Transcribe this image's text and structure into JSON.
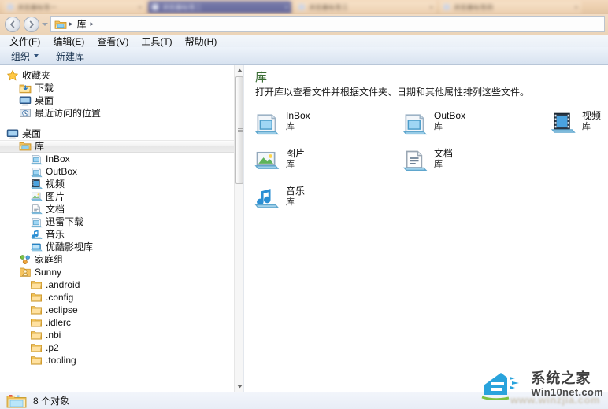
{
  "browser_tabs": {
    "tabs": [
      {
        "title": "浏览器标签一",
        "active": false,
        "icon": "page-icon",
        "close": "×"
      },
      {
        "title": "浏览器标签二",
        "active": true,
        "icon": "page-icon",
        "close": "×"
      },
      {
        "title": "浏览器标签三",
        "active": false,
        "icon": "page-icon",
        "close": "×"
      },
      {
        "title": "浏览器标签四",
        "active": false,
        "icon": "page-icon",
        "close": "×"
      }
    ]
  },
  "navbar": {
    "back_icon": "back-arrow-icon",
    "forward_icon": "forward-arrow-icon",
    "history_dropdown_icon": "chevron-down-icon",
    "address_icon": "library-icon",
    "breadcrumb": [
      "库"
    ],
    "separator": "▸"
  },
  "menubar": {
    "items": [
      {
        "label": "文件(F)",
        "accel": "F"
      },
      {
        "label": "编辑(E)",
        "accel": "E"
      },
      {
        "label": "查看(V)",
        "accel": "V"
      },
      {
        "label": "工具(T)",
        "accel": "T"
      },
      {
        "label": "帮助(H)",
        "accel": "H"
      }
    ]
  },
  "toolbar": {
    "organize_label": "组织",
    "new_library_label": "新建库"
  },
  "sidebar": {
    "groups": [
      {
        "header": {
          "label": "收藏夹",
          "icon": "star-icon",
          "indent": 0,
          "selected": false
        },
        "items": [
          {
            "label": "下载",
            "icon": "downloads-icon",
            "indent": 1,
            "selected": false
          },
          {
            "label": "桌面",
            "icon": "desktop-icon",
            "indent": 1,
            "selected": false
          },
          {
            "label": "最近访问的位置",
            "icon": "recent-places-icon",
            "indent": 1,
            "selected": false
          }
        ]
      },
      {
        "header": {
          "label": "桌面",
          "icon": "desktop-icon",
          "indent": 0,
          "selected": false
        },
        "items": [
          {
            "label": "库",
            "icon": "library-icon",
            "indent": 1,
            "selected": true
          },
          {
            "label": "InBox",
            "icon": "library-generic-icon",
            "indent": 2,
            "selected": false
          },
          {
            "label": "OutBox",
            "icon": "library-generic-icon",
            "indent": 2,
            "selected": false
          },
          {
            "label": "视频",
            "icon": "video-library-icon",
            "indent": 2,
            "selected": false
          },
          {
            "label": "图片",
            "icon": "pictures-library-icon",
            "indent": 2,
            "selected": false
          },
          {
            "label": "文档",
            "icon": "documents-library-icon",
            "indent": 2,
            "selected": false
          },
          {
            "label": "迅雷下载",
            "icon": "library-generic-icon",
            "indent": 2,
            "selected": false
          },
          {
            "label": "音乐",
            "icon": "music-library-icon",
            "indent": 2,
            "selected": false
          },
          {
            "label": "优酷影视库",
            "icon": "youku-library-icon",
            "indent": 2,
            "selected": false
          },
          {
            "label": "家庭组",
            "icon": "homegroup-icon",
            "indent": 1,
            "selected": false
          },
          {
            "label": "Sunny",
            "icon": "user-icon",
            "indent": 1,
            "selected": false
          },
          {
            "label": ".android",
            "icon": "folder-icon",
            "indent": 2,
            "selected": false
          },
          {
            "label": ".config",
            "icon": "folder-icon",
            "indent": 2,
            "selected": false
          },
          {
            "label": ".eclipse",
            "icon": "folder-icon",
            "indent": 2,
            "selected": false
          },
          {
            "label": ".idlerc",
            "icon": "folder-icon",
            "indent": 2,
            "selected": false
          },
          {
            "label": ".nbi",
            "icon": "folder-icon",
            "indent": 2,
            "selected": false
          },
          {
            "label": ".p2",
            "icon": "folder-icon",
            "indent": 2,
            "selected": false
          },
          {
            "label": ".tooling",
            "icon": "folder-icon",
            "indent": 2,
            "selected": false
          }
        ]
      }
    ],
    "scrollbar": {
      "up_icon": "scroll-up-icon",
      "down_icon": "scroll-down-icon"
    }
  },
  "main": {
    "title": "库",
    "description": "打开库以查看文件并根据文件夹、日期和其他属性排列这些文件。",
    "items": [
      {
        "name": "InBox",
        "sub": "库",
        "icon": "library-generic-icon",
        "col": 0,
        "row": 0
      },
      {
        "name": "OutBox",
        "sub": "库",
        "icon": "library-generic-icon",
        "col": 1,
        "row": 0
      },
      {
        "name": "视频",
        "sub": "库",
        "icon": "video-library-icon",
        "col": 2,
        "row": 0
      },
      {
        "name": "图片",
        "sub": "库",
        "icon": "pictures-library-icon",
        "col": 0,
        "row": 1
      },
      {
        "name": "文档",
        "sub": "库",
        "icon": "documents-library-icon",
        "col": 1,
        "row": 1
      },
      {
        "name": "音乐",
        "sub": "库",
        "icon": "music-library-icon",
        "col": 0,
        "row": 2
      }
    ]
  },
  "statusbar": {
    "icon": "library-icon",
    "text": "8 个对象"
  },
  "watermark": {
    "cn": "系统之家",
    "en": "Win10net.com",
    "ghost": "www.winzjia.com",
    "logo_icon": "house-logo-icon"
  },
  "colors": {
    "tab_active": "#6b6ea0",
    "tab_inactive": "#eccfae",
    "navbar": "#ecd4b8",
    "toolbar_top": "#eef3fa",
    "toolbar_bottom": "#d7e2f0",
    "title_green": "#3b6e35",
    "statusbar": "#eef2f9",
    "logo_blue": "#29a3dc",
    "logo_green": "#7ec242"
  }
}
